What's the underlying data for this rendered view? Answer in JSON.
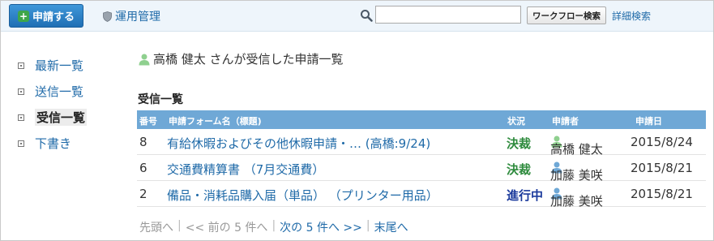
{
  "toolbar": {
    "apply_label": "申請する",
    "admin_label": "運用管理",
    "search_value": "",
    "search_placeholder": "",
    "search_button": "ワークフロー検索",
    "advanced_search": "詳細検索"
  },
  "sidebar": {
    "items": [
      {
        "label": "最新一覧",
        "active": false
      },
      {
        "label": "送信一覧",
        "active": false
      },
      {
        "label": "受信一覧",
        "active": true
      },
      {
        "label": "下書き",
        "active": false
      }
    ]
  },
  "main": {
    "heading": "高橋 健太 さんが受信した申請一覧",
    "section_title": "受信一覧",
    "columns": [
      "番号",
      "申請フォーム名（標題)",
      "状況",
      "申請者",
      "申請日"
    ],
    "rows": [
      {
        "num": "8",
        "title": "有給休暇およびその他休暇申請・… (高橋:9/24)",
        "status": "決裁",
        "status_type": "done",
        "user": "高橋 健太",
        "user_icon": "user-green",
        "date": "2015/8/24"
      },
      {
        "num": "6",
        "title": "交通費精算書 （7月交通費）",
        "status": "決裁",
        "status_type": "done",
        "user": "加藤 美咲",
        "user_icon": "user-blue",
        "date": "2015/8/21"
      },
      {
        "num": "2",
        "title": "備品・消耗品購入届（単品） （プリンター用品）",
        "status": "進行中",
        "status_type": "progress",
        "user": "加藤 美咲",
        "user_icon": "user-blue",
        "date": "2015/8/21"
      }
    ],
    "pager": {
      "first": "先頭へ",
      "prev": "<< 前の 5 件へ",
      "next": "次の 5 件へ >>",
      "last": "末尾へ"
    }
  },
  "colors": {
    "accent": "#1f6aa8",
    "header_bg": "#6fa8d6",
    "status_done": "#2e8b3d",
    "status_progress": "#1b3a9c"
  }
}
